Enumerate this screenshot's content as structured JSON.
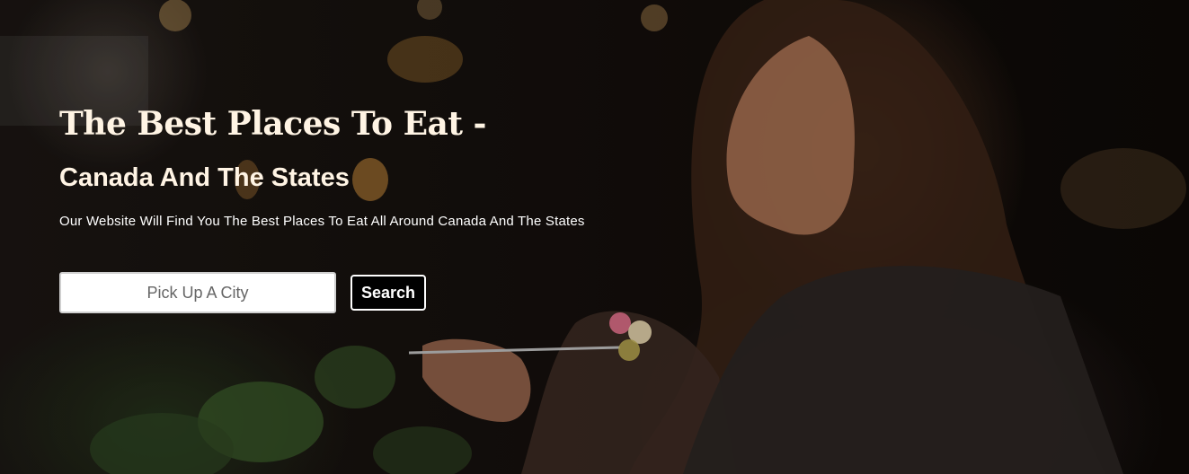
{
  "hero": {
    "background_image": "woman-eating-pasta-restaurant-photo",
    "title": "The Best Places To Eat -",
    "subtitle": "Canada And The States",
    "tagline": "Our Website Will Find You The Best Places To Eat All Around Canada And The States"
  },
  "search": {
    "placeholder": "Pick Up A City",
    "value": "",
    "button_label": "Search"
  },
  "colors": {
    "heading": "#fff4e4",
    "text": "#ffffff",
    "button_bg": "#000000",
    "button_border": "#ffffff",
    "input_bg": "#ffffff"
  }
}
